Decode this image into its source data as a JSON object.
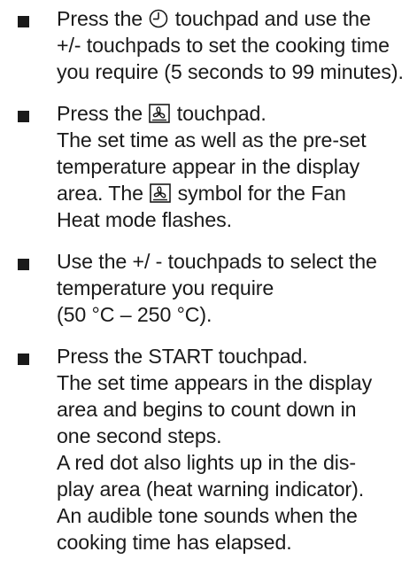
{
  "items": [
    {
      "lines": [
        [
          "Press the ",
          "{timer-icon}",
          " touchpad and use the"
        ],
        [
          "+/- touchpads to set the cooking time"
        ],
        [
          "you require (5 seconds to 99 minutes)."
        ]
      ]
    },
    {
      "lines": [
        [
          "Press the ",
          "{fan-heat-icon}",
          " touchpad."
        ],
        [
          "The set time as well as the pre-set"
        ],
        [
          "temperature appear in the display"
        ],
        [
          "area. The ",
          "{fan-heat-icon}",
          " symbol for the Fan"
        ],
        [
          "Heat mode flashes."
        ]
      ]
    },
    {
      "lines": [
        [
          "Use the +/ - touchpads to select the"
        ],
        [
          "temperature you require"
        ],
        [
          "(50 °C – 250 °C)."
        ]
      ]
    },
    {
      "lines": [
        [
          "Press the START touchpad."
        ],
        [
          "The set time appears in the display"
        ],
        [
          "area and begins to count down in"
        ],
        [
          "one second steps."
        ],
        [
          "A red dot also lights up in the dis-"
        ],
        [
          "play area (heat warning indicator)."
        ],
        [
          "An audible tone sounds when the"
        ],
        [
          "cooking time has elapsed."
        ]
      ]
    }
  ]
}
